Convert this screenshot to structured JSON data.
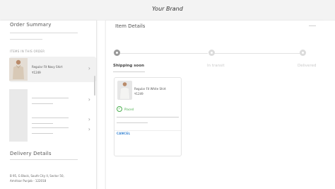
{
  "header": {
    "brand": "Your Brand"
  },
  "sidebar": {
    "title": "Order Summary",
    "items_label": "ITEMS IN THIS ORDER",
    "items": [
      {
        "name": "Regular Fit Navy Shirt",
        "price": "₹1249",
        "shirt_color": "#d8c9b6"
      }
    ],
    "delivery_title": "Delivery Details",
    "address_line1": "B 95, G Block, South City II, Sector 50,",
    "address_line2": "Amritsar Punjab - 122018"
  },
  "panel": {
    "title": "Item Details",
    "steps": [
      {
        "label": "Shipping soon",
        "active": true
      },
      {
        "label": "In transit",
        "active": false
      },
      {
        "label": "Delivered",
        "active": false
      }
    ],
    "item": {
      "name": "Regular Fit White Shirt",
      "price": "₹1249",
      "status": "Placed",
      "cancel_label": "CANCEL",
      "shirt_color": "#f4f4f2"
    }
  },
  "colors": {
    "accent_green": "#4caf50",
    "link_blue": "#2f7fd1"
  }
}
